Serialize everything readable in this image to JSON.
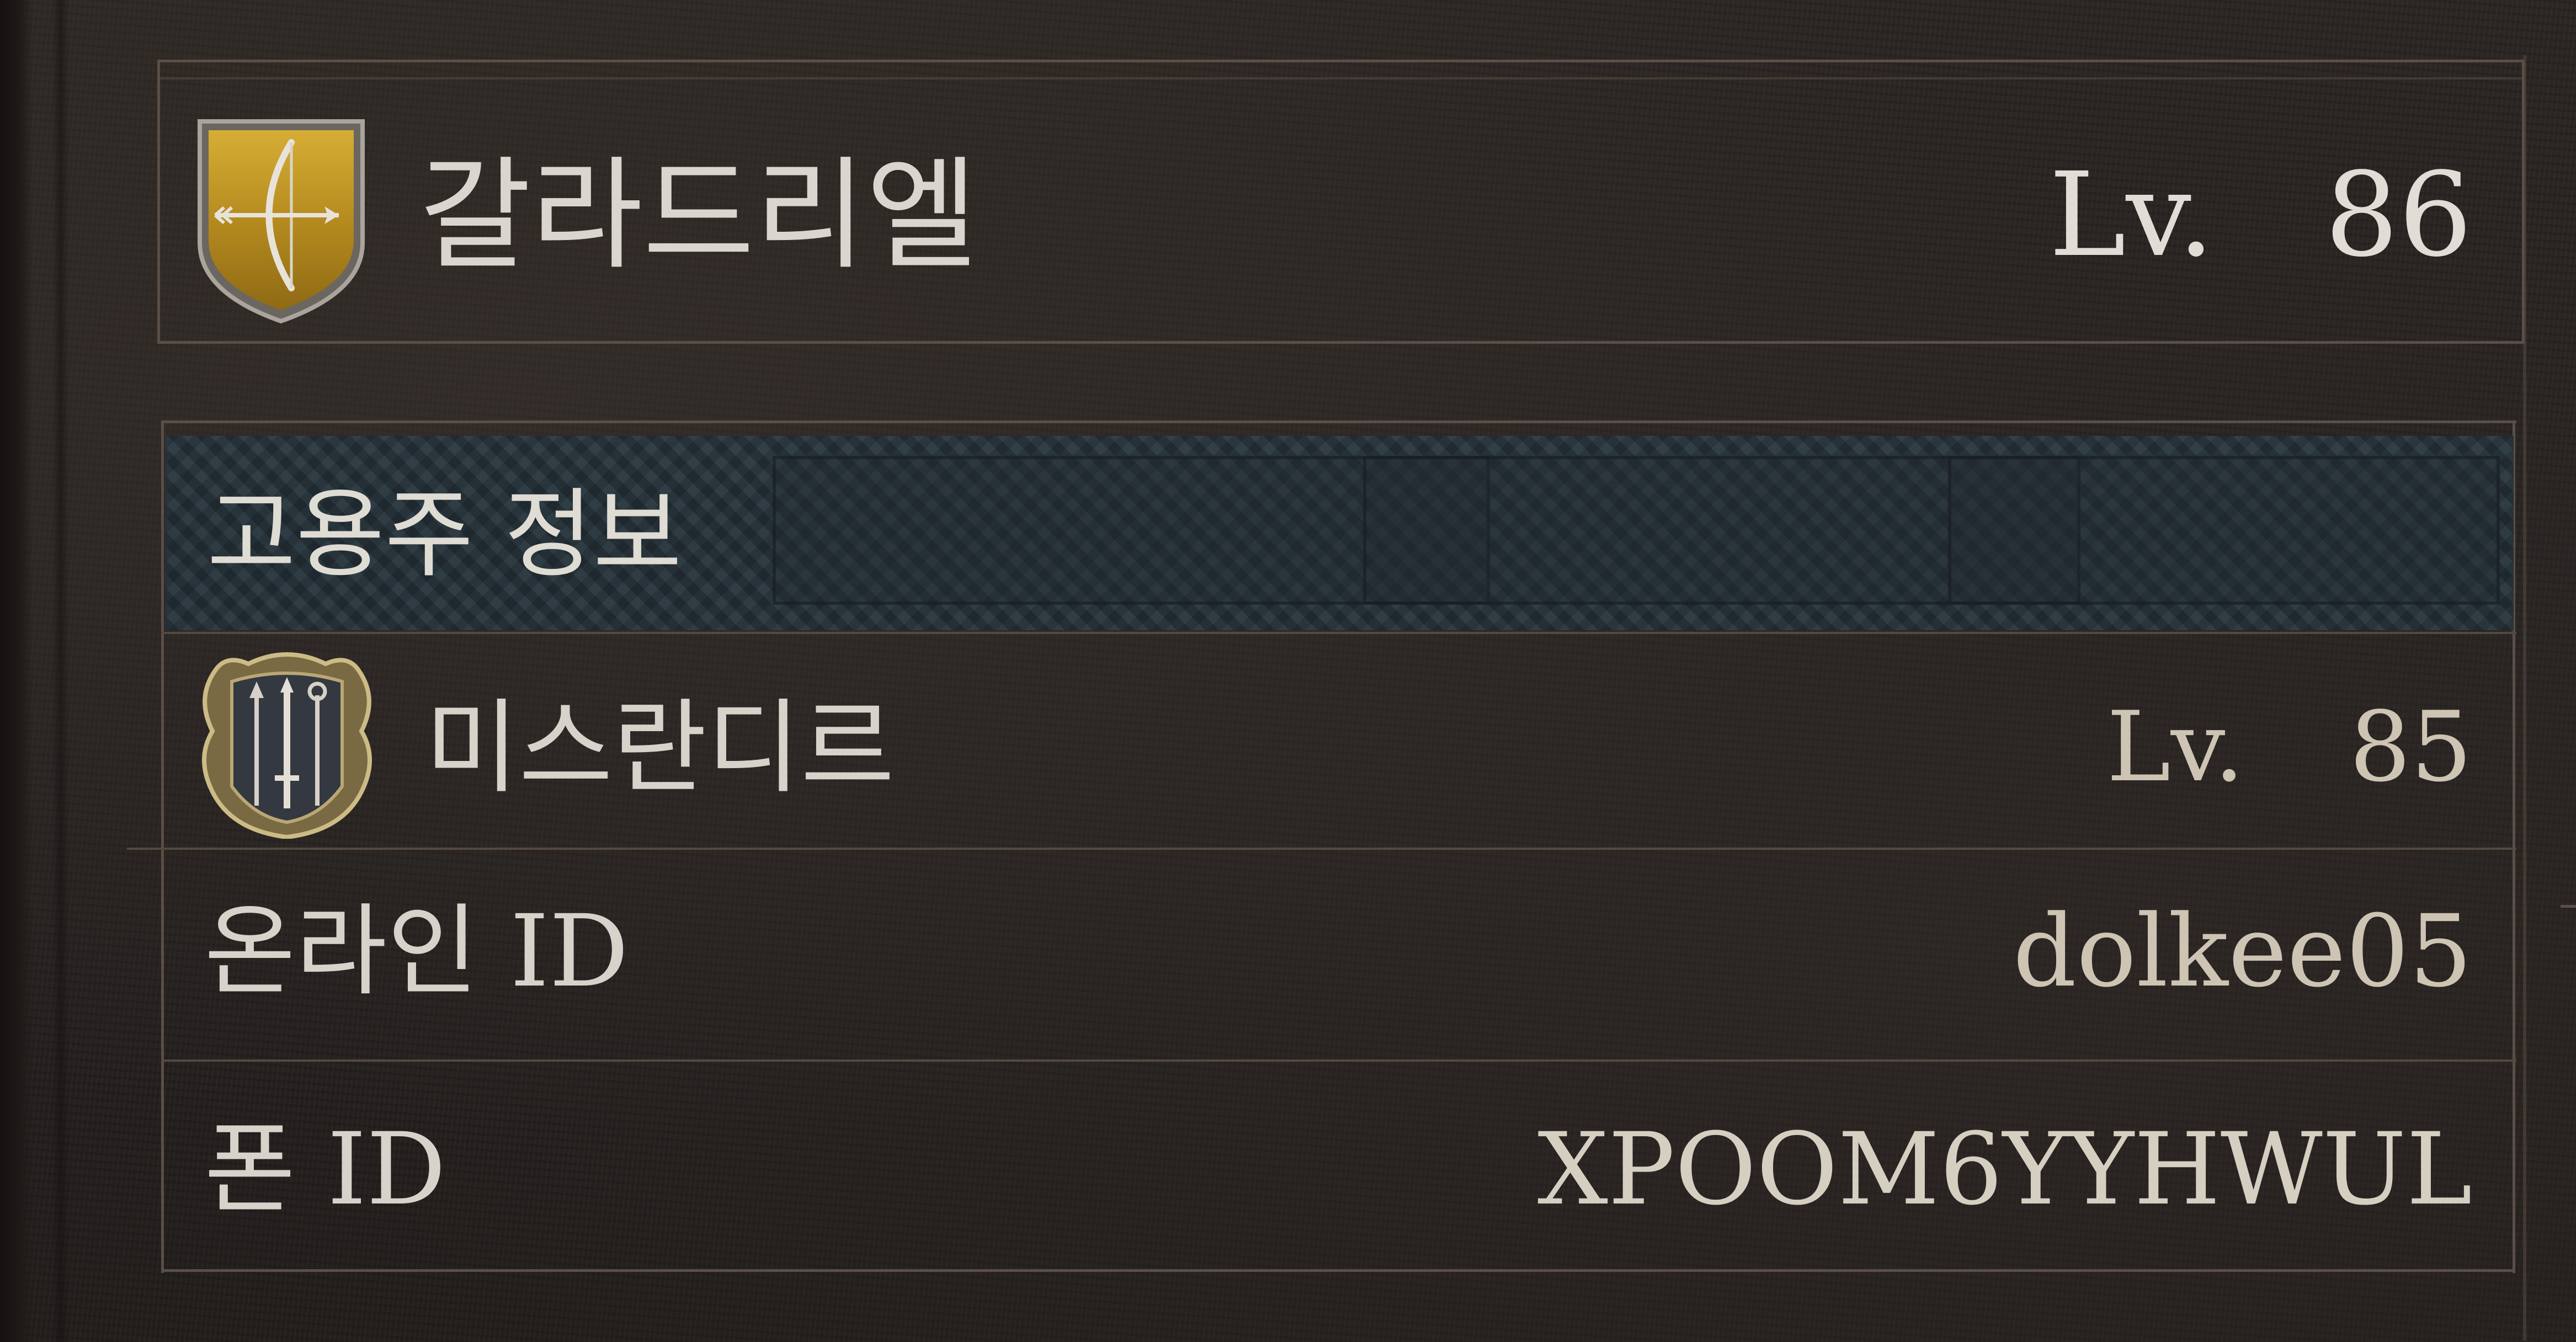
{
  "character": {
    "name": "갈라드리엘",
    "level_label": "Lv.",
    "level": "86",
    "class_icon": "bow-shield-icon"
  },
  "employer_section": {
    "title": "고용주 정보",
    "employer": {
      "name": "미스란디르",
      "level_label": "Lv.",
      "level": "85",
      "class_icon": "weapons-crest-icon"
    },
    "rows": [
      {
        "label": "온라인 ID",
        "value": "dolkee05"
      },
      {
        "label": "폰 ID",
        "value": "XPOOM6YYHWUL"
      }
    ]
  },
  "colors": {
    "text_primary": "#d9d6cf",
    "text_value": "#cdc4b3",
    "frame_line": "#5a4e46",
    "shield_gold": "#b8921f",
    "section_band": "#2f3a40"
  }
}
